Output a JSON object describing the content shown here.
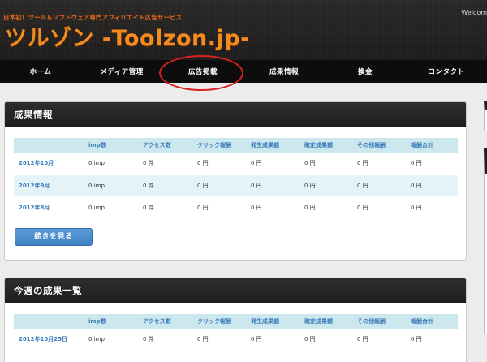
{
  "header": {
    "tagline": "日本初！ツール＆ソフトウェア専門アフィリエイト広告サービス",
    "logo": "ツルゾン -Toolzon.jp-",
    "welcome": "Welcom"
  },
  "nav": {
    "items": [
      "ホーム",
      "メディア管理",
      "広告掲載",
      "成果情報",
      "換金",
      "コンタクト"
    ],
    "highlight_color": "#d8221f"
  },
  "columns": [
    "",
    "imp数",
    "アクセス数",
    "クリック報酬",
    "発生成果額",
    "確定成果額",
    "その他報酬",
    "報酬合計"
  ],
  "panel1": {
    "title": "成果情報",
    "rows": [
      [
        "2012年10月",
        "0 imp",
        "0 件",
        "0 円",
        "0 円",
        "0 円",
        "0 円",
        "0 円"
      ],
      [
        "2012年9月",
        "0 imp",
        "0 件",
        "0 円",
        "0 円",
        "0 円",
        "0 円",
        "0 円"
      ],
      [
        "2012年8月",
        "0 imp",
        "0 件",
        "0 円",
        "0 円",
        "0 円",
        "0 円",
        "0 円"
      ]
    ],
    "more_button": "続きを見る"
  },
  "panel2": {
    "title": "今週の成果一覧",
    "rows": [
      [
        "2012年10月25日",
        "0 imp",
        "0 件",
        "0 円",
        "0 円",
        "0 円",
        "0 円",
        "0 円"
      ]
    ]
  },
  "colors": {
    "accent": "#f58a1e",
    "header_bg": "#1d1c1b",
    "table_header_bg": "#cde7ee",
    "table_header_text": "#3a7cb8",
    "button_bg": "#4a8cce"
  }
}
